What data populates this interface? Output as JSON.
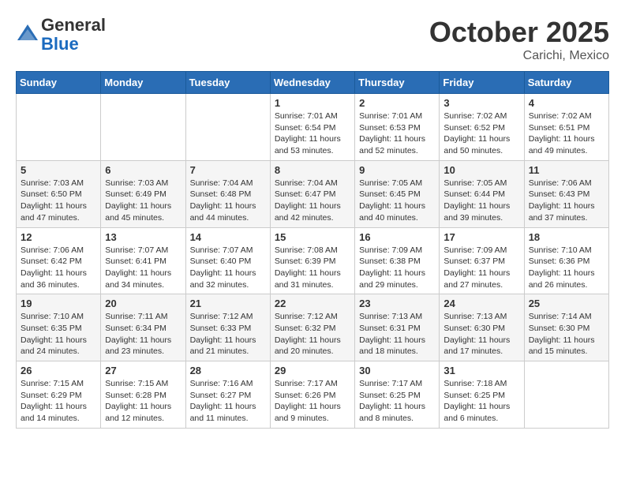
{
  "header": {
    "logo_line1": "General",
    "logo_line2": "Blue",
    "month": "October 2025",
    "location": "Carichi, Mexico"
  },
  "weekdays": [
    "Sunday",
    "Monday",
    "Tuesday",
    "Wednesday",
    "Thursday",
    "Friday",
    "Saturday"
  ],
  "weeks": [
    [
      {
        "day": "",
        "info": ""
      },
      {
        "day": "",
        "info": ""
      },
      {
        "day": "",
        "info": ""
      },
      {
        "day": "1",
        "info": "Sunrise: 7:01 AM\nSunset: 6:54 PM\nDaylight: 11 hours\nand 53 minutes."
      },
      {
        "day": "2",
        "info": "Sunrise: 7:01 AM\nSunset: 6:53 PM\nDaylight: 11 hours\nand 52 minutes."
      },
      {
        "day": "3",
        "info": "Sunrise: 7:02 AM\nSunset: 6:52 PM\nDaylight: 11 hours\nand 50 minutes."
      },
      {
        "day": "4",
        "info": "Sunrise: 7:02 AM\nSunset: 6:51 PM\nDaylight: 11 hours\nand 49 minutes."
      }
    ],
    [
      {
        "day": "5",
        "info": "Sunrise: 7:03 AM\nSunset: 6:50 PM\nDaylight: 11 hours\nand 47 minutes."
      },
      {
        "day": "6",
        "info": "Sunrise: 7:03 AM\nSunset: 6:49 PM\nDaylight: 11 hours\nand 45 minutes."
      },
      {
        "day": "7",
        "info": "Sunrise: 7:04 AM\nSunset: 6:48 PM\nDaylight: 11 hours\nand 44 minutes."
      },
      {
        "day": "8",
        "info": "Sunrise: 7:04 AM\nSunset: 6:47 PM\nDaylight: 11 hours\nand 42 minutes."
      },
      {
        "day": "9",
        "info": "Sunrise: 7:05 AM\nSunset: 6:45 PM\nDaylight: 11 hours\nand 40 minutes."
      },
      {
        "day": "10",
        "info": "Sunrise: 7:05 AM\nSunset: 6:44 PM\nDaylight: 11 hours\nand 39 minutes."
      },
      {
        "day": "11",
        "info": "Sunrise: 7:06 AM\nSunset: 6:43 PM\nDaylight: 11 hours\nand 37 minutes."
      }
    ],
    [
      {
        "day": "12",
        "info": "Sunrise: 7:06 AM\nSunset: 6:42 PM\nDaylight: 11 hours\nand 36 minutes."
      },
      {
        "day": "13",
        "info": "Sunrise: 7:07 AM\nSunset: 6:41 PM\nDaylight: 11 hours\nand 34 minutes."
      },
      {
        "day": "14",
        "info": "Sunrise: 7:07 AM\nSunset: 6:40 PM\nDaylight: 11 hours\nand 32 minutes."
      },
      {
        "day": "15",
        "info": "Sunrise: 7:08 AM\nSunset: 6:39 PM\nDaylight: 11 hours\nand 31 minutes."
      },
      {
        "day": "16",
        "info": "Sunrise: 7:09 AM\nSunset: 6:38 PM\nDaylight: 11 hours\nand 29 minutes."
      },
      {
        "day": "17",
        "info": "Sunrise: 7:09 AM\nSunset: 6:37 PM\nDaylight: 11 hours\nand 27 minutes."
      },
      {
        "day": "18",
        "info": "Sunrise: 7:10 AM\nSunset: 6:36 PM\nDaylight: 11 hours\nand 26 minutes."
      }
    ],
    [
      {
        "day": "19",
        "info": "Sunrise: 7:10 AM\nSunset: 6:35 PM\nDaylight: 11 hours\nand 24 minutes."
      },
      {
        "day": "20",
        "info": "Sunrise: 7:11 AM\nSunset: 6:34 PM\nDaylight: 11 hours\nand 23 minutes."
      },
      {
        "day": "21",
        "info": "Sunrise: 7:12 AM\nSunset: 6:33 PM\nDaylight: 11 hours\nand 21 minutes."
      },
      {
        "day": "22",
        "info": "Sunrise: 7:12 AM\nSunset: 6:32 PM\nDaylight: 11 hours\nand 20 minutes."
      },
      {
        "day": "23",
        "info": "Sunrise: 7:13 AM\nSunset: 6:31 PM\nDaylight: 11 hours\nand 18 minutes."
      },
      {
        "day": "24",
        "info": "Sunrise: 7:13 AM\nSunset: 6:30 PM\nDaylight: 11 hours\nand 17 minutes."
      },
      {
        "day": "25",
        "info": "Sunrise: 7:14 AM\nSunset: 6:30 PM\nDaylight: 11 hours\nand 15 minutes."
      }
    ],
    [
      {
        "day": "26",
        "info": "Sunrise: 7:15 AM\nSunset: 6:29 PM\nDaylight: 11 hours\nand 14 minutes."
      },
      {
        "day": "27",
        "info": "Sunrise: 7:15 AM\nSunset: 6:28 PM\nDaylight: 11 hours\nand 12 minutes."
      },
      {
        "day": "28",
        "info": "Sunrise: 7:16 AM\nSunset: 6:27 PM\nDaylight: 11 hours\nand 11 minutes."
      },
      {
        "day": "29",
        "info": "Sunrise: 7:17 AM\nSunset: 6:26 PM\nDaylight: 11 hours\nand 9 minutes."
      },
      {
        "day": "30",
        "info": "Sunrise: 7:17 AM\nSunset: 6:25 PM\nDaylight: 11 hours\nand 8 minutes."
      },
      {
        "day": "31",
        "info": "Sunrise: 7:18 AM\nSunset: 6:25 PM\nDaylight: 11 hours\nand 6 minutes."
      },
      {
        "day": "",
        "info": ""
      }
    ]
  ]
}
